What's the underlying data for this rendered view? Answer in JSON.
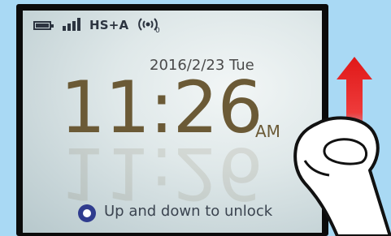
{
  "status_bar": {
    "network_label": "HS+A",
    "wifi_clients": "0",
    "icons": [
      "battery-icon",
      "signal-icon",
      "wifi-hotspot-icon"
    ]
  },
  "lock_screen": {
    "date": "2016/2/23 Tue",
    "time": "11:26",
    "ampm": "AM",
    "unlock_hint": "Up and down to unlock"
  },
  "colors": {
    "time": "#6b5a36",
    "accent_dot": "#2f3c8e",
    "arrow": "#e02020",
    "background": "#a9d9f4"
  }
}
